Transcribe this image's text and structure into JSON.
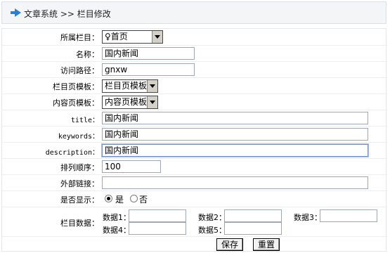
{
  "breadcrumb": {
    "section": "文章系统",
    "separator": ">>",
    "page": "栏目修改"
  },
  "fields": {
    "parent": {
      "label": "所属栏目：",
      "value": "♀首页"
    },
    "name": {
      "label": "名称：",
      "value": "国内新闻"
    },
    "path": {
      "label": "访问路径：",
      "value": "gnxw"
    },
    "list_template": {
      "label": "栏目页模板：",
      "value": "栏目页模板"
    },
    "content_template": {
      "label": "内容页模板：",
      "value": "内容页模板"
    },
    "title": {
      "label": "title：",
      "value": "国内新闻"
    },
    "keywords": {
      "label": "keywords：",
      "value": "国内新闻"
    },
    "description": {
      "label": "description：",
      "value": "国内新闻"
    },
    "order": {
      "label": "排列顺序：",
      "value": "100"
    },
    "external_link": {
      "label": "外部链接：",
      "value": ""
    },
    "display": {
      "label": "是否显示：",
      "yes": "是",
      "no": "否",
      "selected": "是"
    },
    "data": {
      "label": "栏目数据：",
      "items": [
        {
          "label": "数据1：",
          "value": ""
        },
        {
          "label": "数据2：",
          "value": ""
        },
        {
          "label": "数据3：",
          "value": ""
        },
        {
          "label": "数据4：",
          "value": ""
        },
        {
          "label": "数据5：",
          "value": ""
        }
      ]
    }
  },
  "buttons": {
    "save": "保存",
    "reset": "重置"
  },
  "colors": {
    "header_bg": "#f4f5f7",
    "arrow": "#2a7fd4"
  }
}
